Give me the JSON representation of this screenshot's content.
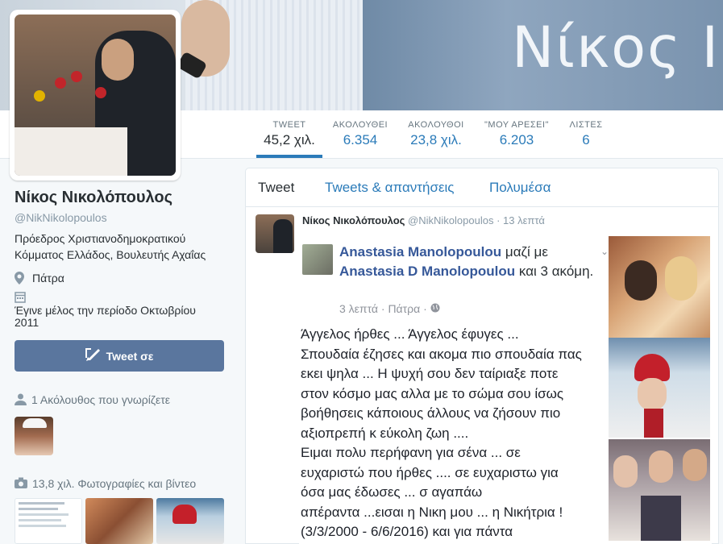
{
  "banner": {
    "name_text": "Νίκος Ι."
  },
  "nav": {
    "stats": [
      {
        "label": "TWEET",
        "value": "45,2 χιλ."
      },
      {
        "label": "ΑΚΟΛΟΥΘΕΙ",
        "value": "6.354"
      },
      {
        "label": "ΑΚΟΛΟΥΘΟΙ",
        "value": "23,8 χιλ."
      },
      {
        "label": "\"ΜΟΥ ΑΡΕΣΕΙ\"",
        "value": "6.203"
      },
      {
        "label": "ΛΙΣΤΕΣ",
        "value": "6"
      }
    ]
  },
  "profile": {
    "name": "Νίκος Νικολόπουλος",
    "handle": "@NikNikolopoulos",
    "bio": "Πρόεδρος Χριστιανοδημοκρατικού Κόμματος Ελλάδος, Βουλευτής Αχαΐας",
    "location": "Πάτρα",
    "joined": "Έγινε μέλος την περίοδο Οκτωβρίου 2011",
    "tweet_button": "Tweet σε",
    "known_followers": "1 Ακόλουθος που γνωρίζετε",
    "photos": "13,8 χιλ. Φωτογραφίες και βίντεο"
  },
  "timeline": {
    "tabs": [
      "Tweet",
      "Tweets & απαντήσεις",
      "Πολυμέσα"
    ],
    "tweet": {
      "author": "Νίκος Νικολόπουλος",
      "handle": "@NikNikolopoulos",
      "sep": "·",
      "time": "13 λεπτά"
    },
    "embed": {
      "title_name1": "Anastasia Manolopoulou",
      "title_with": " μαζί με ",
      "title_name2": "Anastasia D Manolopoulou",
      "title_rest": " και 3 ακόμη.",
      "meta": "3 λεπτά · Πάτρα ·",
      "lines": [
        "Άγγελος ήρθες ... Άγγελος έφυγες ...",
        "Σπουδαία έζησες και ακομα πιο σπουδαία πας",
        "εκει ψηλα ... Η ψυχή σου δεν ταίριαξε ποτε",
        "στον κόσμο μας αλλα με το σώμα σου ίσως",
        "βοήθησεις κάποιους άλλους να ζήσουν πιο",
        "αξιοπρεπή κ εύκολη ζωη  ....",
        "Ειμαι πολυ περήφανη για σένα ... σε",
        "ευχαριστώ που ήρθες .... σε ευχαριστω για",
        "όσα μας έδωσες ... σ αγαπάω",
        "απέραντα ...εισαι η Νικη μου ... η Νικήτρια !",
        "(3/3/2000 - 6/6/2016) και για πάντα"
      ]
    }
  },
  "icons": {
    "location": "map-pin-icon",
    "calendar": "calendar-icon",
    "user": "user-icon",
    "camera": "camera-icon",
    "quill": "quill-icon",
    "globe": "globe-icon"
  },
  "colors": {
    "link": "#2b7bb9",
    "button": "#5a769e",
    "fb_link": "#365899"
  }
}
